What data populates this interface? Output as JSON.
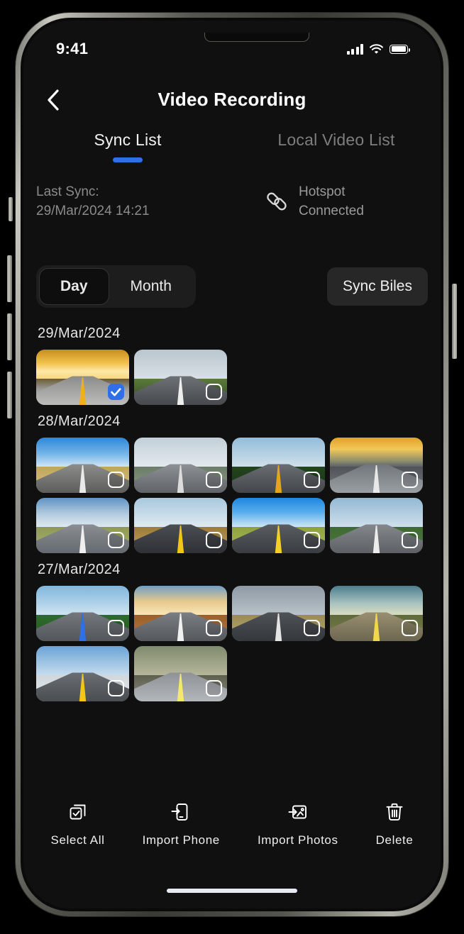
{
  "status_bar": {
    "time": "9:41",
    "signal_icon": "cellular-signal-icon",
    "wifi_icon": "wifi-icon",
    "battery_icon": "battery-full-icon"
  },
  "nav": {
    "back_icon": "chevron-left-icon",
    "title": "Video Recording"
  },
  "tabs": [
    {
      "label": "Sync List",
      "active": true
    },
    {
      "label": "Local Video List",
      "active": false
    }
  ],
  "sync_info": {
    "last_sync_label": "Last Sync:",
    "last_sync_value": "29/Mar/2024 14:21",
    "connection_icon": "link-icon",
    "connection_line1": "Hotspot",
    "connection_line2": "Connected"
  },
  "filters": {
    "segments": [
      {
        "label": "Day",
        "active": true
      },
      {
        "label": "Month",
        "active": false
      }
    ],
    "sync_button_label": "Sync Biles"
  },
  "colors": {
    "accent": "#2f6fe8",
    "screen_bg": "#101010",
    "segment_bg": "#1d1d1d",
    "button_bg": "#272727",
    "text_primary": "#f2f2f2",
    "text_muted": "#8b8b8b"
  },
  "gallery": {
    "groups": [
      {
        "date": "29/Mar/2024",
        "items": [
          {
            "name": "sunset-highway-double-yellow",
            "selected": true,
            "sky": "linear-gradient(180deg,#c88c20,#f0c04a 45%,#ffe9a8 75%,#f7d77e 100%)",
            "ground": "linear-gradient(180deg,#6d5c33,#9b9b9b 40%,#c9c9c9)",
            "road": "linear-gradient(180deg,#8b8b89,#bdbdbb)",
            "lane": "#f0b01c"
          },
          {
            "name": "green-hills-curving-road",
            "selected": false,
            "sky": "linear-gradient(180deg,#b9c6cf,#d8e0e4)",
            "ground": "linear-gradient(180deg,#5c7a3b,#3f5c2c 60%,#44602f)",
            "road": "linear-gradient(180deg,#6e7277,#464a4f)",
            "lane": "#ededed"
          }
        ]
      },
      {
        "date": "28/Mar/2024",
        "items": [
          {
            "name": "blue-sky-cumulus-prairie-road",
            "selected": false,
            "sky": "linear-gradient(180deg,#2f86d8,#72b5e8 55%,#cfe4f4)",
            "ground": "linear-gradient(180deg,#c2a55a,#d9c489)",
            "road": "linear-gradient(180deg,#8d8d8b,#5d5d5b)",
            "lane": "#e9e9e9"
          },
          {
            "name": "mountain-valley-straight-road",
            "selected": false,
            "sky": "linear-gradient(180deg,#c2cfd8,#e3eaee)",
            "ground": "linear-gradient(180deg,#6b7d6a,#8e9a7e)",
            "road": "linear-gradient(180deg,#8e9195,#5f6266)",
            "lane": "#dcdcdc"
          },
          {
            "name": "forest-highway-with-cars",
            "selected": false,
            "sky": "linear-gradient(180deg,#93bcd9,#cfe0ea)",
            "ground": "linear-gradient(180deg,#23451d,#18331a)",
            "road": "linear-gradient(180deg,#6a6d72,#43464b)",
            "lane": "#e5a41c"
          },
          {
            "name": "sunset-desert-highway",
            "selected": false,
            "sky": "linear-gradient(180deg,#e0a224,#f2c75a 40%,#8f8f6a 80%,#5d6168)",
            "ground": "linear-gradient(180deg,#4f5257,#76797e)",
            "road": "linear-gradient(180deg,#70757b,#9a9ea3)",
            "lane": "#e8e8e8"
          },
          {
            "name": "poplar-trees-country-road",
            "selected": false,
            "sky": "linear-gradient(180deg,#5f93c4,#b9cfe0 60%,#dce9f1)",
            "ground": "linear-gradient(180deg,#8c9a56,#b3b46a)",
            "road": "linear-gradient(180deg,#8b8e93,#646a6f)",
            "lane": "#efefef"
          },
          {
            "name": "golden-fields-yellow-line-road",
            "selected": false,
            "sky": "linear-gradient(180deg,#a8c8dd,#dfeaf1)",
            "ground": "linear-gradient(180deg,#9c7b3a,#c6a45c)",
            "road": "linear-gradient(180deg,#4b4e53,#2e3135)",
            "lane": "#f2c518"
          },
          {
            "name": "windmill-green-hill-road",
            "selected": false,
            "sky": "linear-gradient(180deg,#1f86e0,#58aeec 50%,#cfe6f7)",
            "ground": "linear-gradient(180deg,#8ca23f,#b0bd57)",
            "road": "linear-gradient(180deg,#5a5d62,#393c40)",
            "lane": "#f4cf24"
          },
          {
            "name": "tree-lined-dual-carriageway",
            "selected": false,
            "sky": "linear-gradient(180deg,#93b8d4,#cfe0ec)",
            "ground": "linear-gradient(180deg,#3e6b33,#4f7a3c)",
            "road": "linear-gradient(180deg,#84888d,#5d6165)",
            "lane": "#ececec"
          }
        ]
      },
      {
        "date": "27/Mar/2024",
        "items": [
          {
            "name": "forest-road-red-blue-markings",
            "selected": false,
            "sky": "linear-gradient(180deg,#7fb6dd,#cfe4f1)",
            "ground": "linear-gradient(180deg,#2e6b2a,#245a24)",
            "road": "linear-gradient(180deg,#74787d,#53575b)",
            "lane": "#2f6fe8"
          },
          {
            "name": "autumn-sunrise-arrow-road",
            "selected": false,
            "sky": "linear-gradient(180deg,#6f9fc6,#e8c98c 55%,#f8e6b8)",
            "ground": "linear-gradient(180deg,#9a5f2c,#b87a3a)",
            "road": "linear-gradient(180deg,#7b7f84,#55595e)",
            "lane": "#f1f1f1"
          },
          {
            "name": "misty-mountain-prairie-road",
            "selected": false,
            "sky": "linear-gradient(180deg,#8e9aa4,#b9c2c9)",
            "ground": "linear-gradient(180deg,#9a8a54,#bdae73)",
            "road": "linear-gradient(180deg,#4f5358,#34383c)",
            "lane": "#e4e4e4"
          },
          {
            "name": "dramatic-clouds-forest-road",
            "selected": false,
            "sky": "linear-gradient(180deg,#4c7d8e,#a8c3c0 60%,#d9dcc0)",
            "ground": "linear-gradient(180deg,#5e6a3a,#7f7c4c)",
            "road": "linear-gradient(180deg,#9a8f72,#6d674f)",
            "lane": "#f0d84a"
          },
          {
            "name": "snow-mountains-highway",
            "selected": false,
            "sky": "linear-gradient(180deg,#6ba3d6,#c6dcee)",
            "ground": "linear-gradient(180deg,#cfd7dd,#e6ebee)",
            "road": "linear-gradient(180deg,#6a6e73,#4a4e52)",
            "lane": "#f2c518"
          },
          {
            "name": "crosswalk-tree-avenue",
            "selected": false,
            "sky": "linear-gradient(180deg,#7f8a6f,#b6b79a)",
            "ground": "linear-gradient(180deg,#5f5f4e,#8b8b7c)",
            "road": "linear-gradient(180deg,#8e9196,#b3b6ba)",
            "lane": "#f4e96a"
          }
        ]
      }
    ]
  },
  "toolbar": [
    {
      "label": "Select All",
      "icon": "select-all-icon"
    },
    {
      "label": "Import Phone",
      "icon": "import-phone-icon"
    },
    {
      "label": "Import Photos",
      "icon": "import-photos-icon"
    },
    {
      "label": "Delete",
      "icon": "trash-icon"
    }
  ]
}
